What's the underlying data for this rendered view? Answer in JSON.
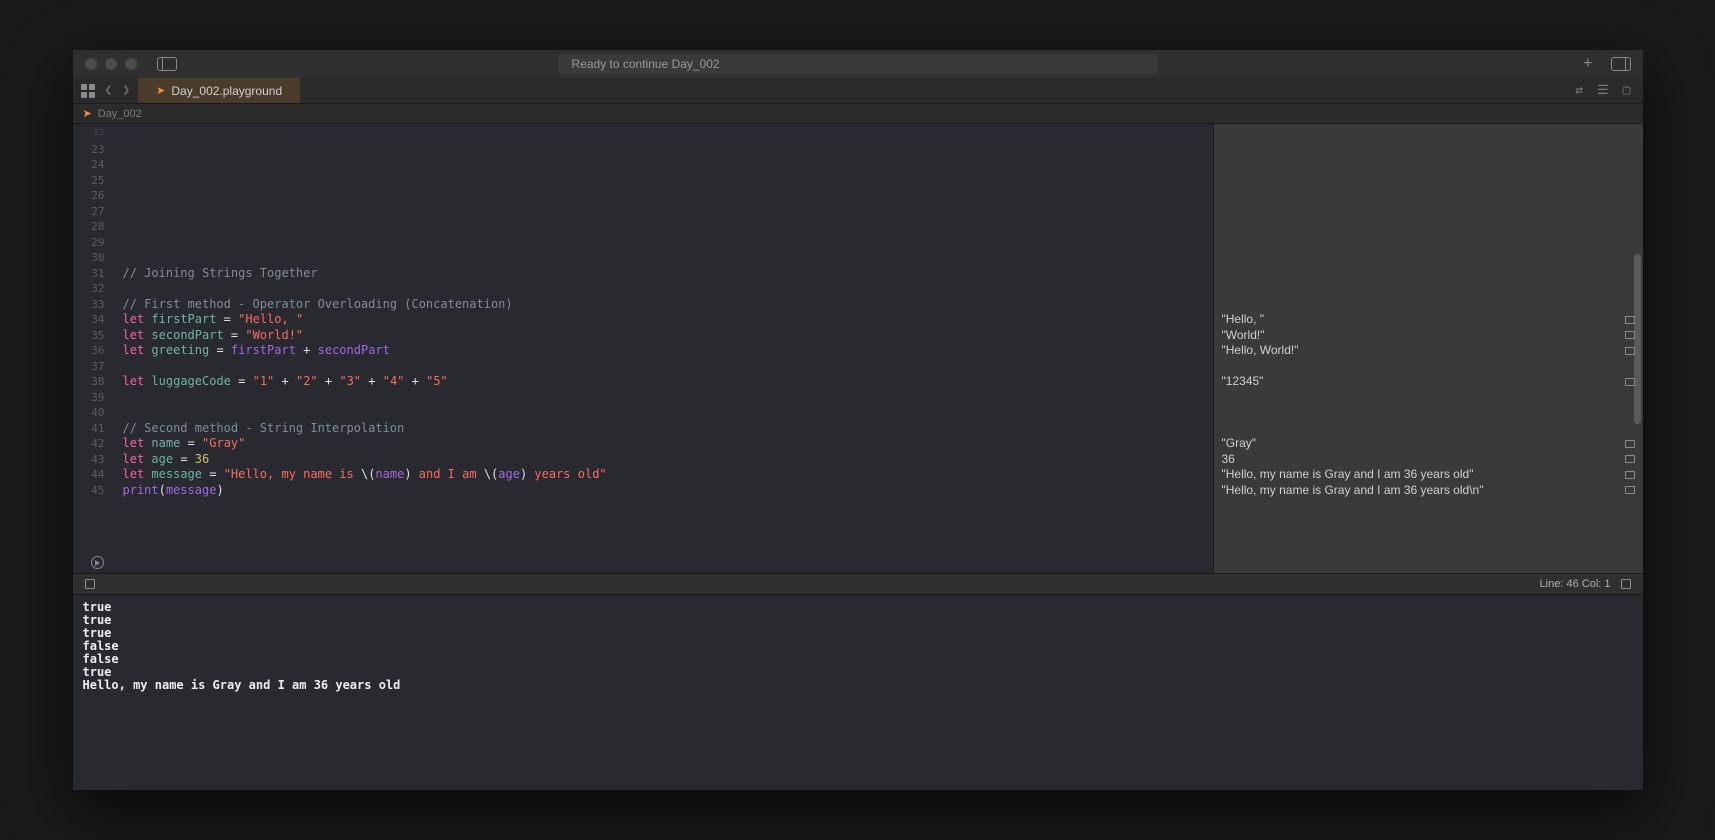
{
  "window": {
    "title_status": "Ready to continue Day_002"
  },
  "tab": {
    "label": "Day_002.playground"
  },
  "breadcrumb": {
    "item": "Day_002"
  },
  "gutter": {
    "start": 22,
    "end": 45
  },
  "code": {
    "22": "",
    "23": "",
    "24": "",
    "25": "",
    "26": "",
    "27": "",
    "28": "",
    "29": "",
    "30": "",
    "31": {
      "type": "comment",
      "text": "// Joining Strings Together"
    },
    "32": "",
    "33": {
      "type": "comment",
      "text": "// First method - Operator Overloading (Concatenation)"
    },
    "34": {
      "type": "let",
      "name": "firstPart",
      "rhs": [
        {
          "t": "str",
          "v": "\"Hello, \""
        }
      ]
    },
    "35": {
      "type": "let",
      "name": "secondPart",
      "rhs": [
        {
          "t": "str",
          "v": "\"World!\""
        }
      ]
    },
    "36": {
      "type": "let",
      "name": "greeting",
      "rhs": [
        {
          "t": "id2",
          "v": "firstPart"
        },
        {
          "t": "op",
          "v": " + "
        },
        {
          "t": "id2",
          "v": "secondPart"
        }
      ]
    },
    "37": "",
    "38": {
      "type": "let",
      "name": "luggageCode",
      "rhs": [
        {
          "t": "str",
          "v": "\"1\""
        },
        {
          "t": "op",
          "v": " + "
        },
        {
          "t": "str",
          "v": "\"2\""
        },
        {
          "t": "op",
          "v": " + "
        },
        {
          "t": "str",
          "v": "\"3\""
        },
        {
          "t": "op",
          "v": " + "
        },
        {
          "t": "str",
          "v": "\"4\""
        },
        {
          "t": "op",
          "v": " + "
        },
        {
          "t": "str",
          "v": "\"5\""
        }
      ]
    },
    "39": "",
    "40": "",
    "41": {
      "type": "comment",
      "text": "// Second method - String Interpolation"
    },
    "42": {
      "type": "let",
      "name": "name",
      "rhs": [
        {
          "t": "str",
          "v": "\"Gray\""
        }
      ]
    },
    "43": {
      "type": "let",
      "name": "age",
      "rhs": [
        {
          "t": "num",
          "v": "36"
        }
      ]
    },
    "44": {
      "type": "let",
      "name": "message",
      "rhs": [
        {
          "t": "str",
          "v": "\"Hello, my name is "
        },
        {
          "t": "op",
          "v": "\\("
        },
        {
          "t": "id2",
          "v": "name"
        },
        {
          "t": "op",
          "v": ")"
        },
        {
          "t": "str",
          "v": " and I am "
        },
        {
          "t": "op",
          "v": "\\("
        },
        {
          "t": "id2",
          "v": "age"
        },
        {
          "t": "op",
          "v": ")"
        },
        {
          "t": "str",
          "v": " years old\""
        }
      ]
    },
    "45": {
      "type": "call",
      "fn": "print",
      "args": [
        {
          "t": "id2",
          "v": "message"
        }
      ]
    }
  },
  "results": {
    "34": {
      "text": "\"Hello, \"",
      "box": true
    },
    "35": {
      "text": "\"World!\"",
      "box": true
    },
    "36": {
      "text": "\"Hello, World!\"",
      "box": true
    },
    "38": {
      "text": "\"12345\"",
      "box": true
    },
    "42": {
      "text": "\"Gray\"",
      "box": true
    },
    "43": {
      "text": "36",
      "box": true
    },
    "44": {
      "text": "\"Hello, my name is Gray and I am 36 years old\"",
      "box": true
    },
    "45": {
      "text": "\"Hello, my name is Gray and I am 36 years old\\n\"",
      "box": true
    }
  },
  "status": {
    "line_col": "Line: 46  Col: 1"
  },
  "console": {
    "lines": [
      "true",
      "true",
      "true",
      "false",
      "false",
      "true",
      "Hello, my name is Gray and I am 36 years old"
    ]
  }
}
